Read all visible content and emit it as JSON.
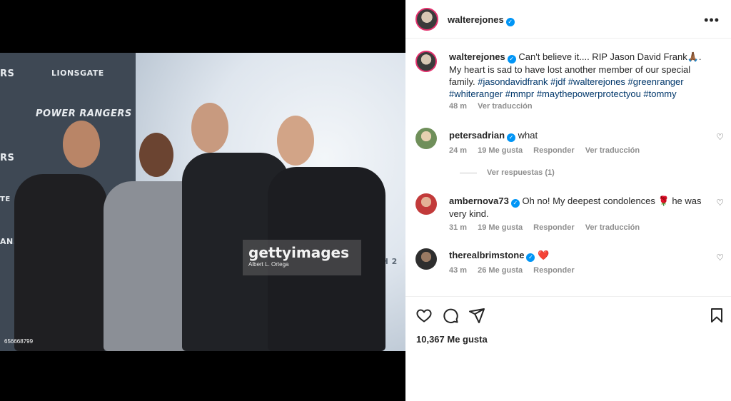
{
  "post": {
    "author": "walterejones",
    "photo": {
      "brand_top": "LIONSGATE",
      "brand_title": "POWER RANGERS",
      "side_text_1": "RS",
      "side_text_2": "RS",
      "side_text_3": "TE",
      "side_text_4": "AN.",
      "watermark_main": "gettyimages",
      "watermark_credit": "Albert L. Ortega",
      "image_id": "656668799",
      "side_right": "CH 2"
    },
    "caption": {
      "username": "walterejones",
      "text": "Can't believe it.... RIP Jason David Frank🙏🏾. My heart is sad to have lost another member of our special family.",
      "hashtags": "#jasondavidfrank #jdf #walterejones #greenranger #whiteranger #mmpr #maythepowerprotectyou #tommy",
      "time": "48 m",
      "translate": "Ver traducción"
    },
    "comments": [
      {
        "username": "petersadrian",
        "text": "what",
        "time": "24 m",
        "likes": "19 Me gusta",
        "reply": "Responder",
        "translate": "Ver traducción",
        "view_replies": "Ver respuestas (1)"
      },
      {
        "username": "ambernova73",
        "text": "Oh no! My deepest condolences 🌹 he was very kind.",
        "time": "31 m",
        "likes": "19 Me gusta",
        "reply": "Responder",
        "translate": "Ver traducción"
      },
      {
        "username": "therealbrimstone",
        "text": "❤️",
        "time": "43 m",
        "likes": "26 Me gusta",
        "reply": "Responder"
      }
    ],
    "like_count": "10,367 Me gusta",
    "more_options": "•••",
    "verified_icon": "verified-icon",
    "colors": {
      "link": "#00376b",
      "verified": "#0095f6",
      "muted": "#8e8e8e",
      "ring": "#e1306c"
    }
  }
}
